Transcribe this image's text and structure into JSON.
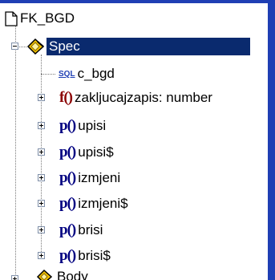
{
  "tree": {
    "root": {
      "label": "FK_BGD",
      "icon": "document-icon"
    },
    "spec": {
      "label": "Spec",
      "icon": "package-spec-icon",
      "selected": true,
      "expanded": true
    },
    "sql_item": {
      "label": "c_bgd",
      "icon_text": "SQL"
    },
    "items": [
      {
        "glyph": "f()",
        "label": "zakljucajzapis: number",
        "kind": "function"
      },
      {
        "glyph": "p()",
        "label": "upisi",
        "kind": "procedure"
      },
      {
        "glyph": "p()",
        "label": "upisi$",
        "kind": "procedure"
      },
      {
        "glyph": "p()",
        "label": "izmjeni",
        "kind": "procedure"
      },
      {
        "glyph": "p()",
        "label": "izmjeni$",
        "kind": "procedure"
      },
      {
        "glyph": "p()",
        "label": "brisi",
        "kind": "procedure"
      },
      {
        "glyph": "p()",
        "label": "brisi$",
        "kind": "procedure"
      }
    ],
    "body": {
      "label": "Body",
      "icon": "package-body-icon"
    }
  },
  "colors": {
    "selection": "#0a2a6e",
    "function_glyph": "#8b0000",
    "procedure_glyph": "#000080",
    "frame": "#1f3fb4"
  }
}
